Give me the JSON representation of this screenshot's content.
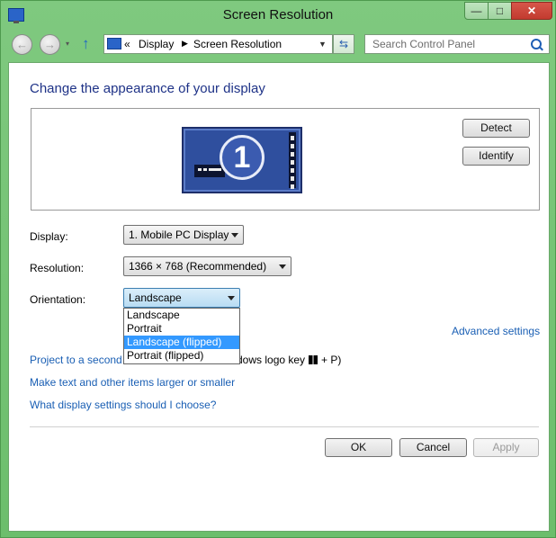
{
  "window": {
    "title": "Screen Resolution"
  },
  "title_buttons": {
    "minimize": "—",
    "maximize": "□",
    "close": "✕"
  },
  "nav": {
    "back_icon": "arrow-left-icon",
    "forward_icon": "arrow-right-icon",
    "recent_glyph": "▾",
    "up_glyph": "↑",
    "address": {
      "prefix": "«",
      "crumbs": [
        "Display",
        "Screen Resolution"
      ],
      "separator": "▶",
      "dropdown_glyph": "▼"
    },
    "refresh_glyph": "⇆",
    "search_placeholder": "Search Control Panel"
  },
  "main": {
    "heading": "Change the appearance of your display",
    "monitor_number": "1",
    "detect_label": "Detect",
    "identify_label": "Identify",
    "fields": {
      "display": {
        "label": "Display:",
        "value": "1. Mobile PC Display"
      },
      "resolution": {
        "label": "Resolution:",
        "value": "1366 × 768 (Recommended)"
      },
      "orientation": {
        "label": "Orientation:",
        "value": "Landscape",
        "options": [
          "Landscape",
          "Portrait",
          "Landscape (flipped)",
          "Portrait (flipped)"
        ],
        "highlighted_index": 2
      }
    },
    "advanced_link": "Advanced settings",
    "project_link": "Project to a second",
    "project_tail_text": "dows logo key",
    "project_tail_suffix": "+ P)",
    "text_size_link": "Make text and other items larger or smaller",
    "choose_link": "What display settings should I choose?",
    "ok_label": "OK",
    "cancel_label": "Cancel",
    "apply_label": "Apply"
  },
  "colors": {
    "frame": "#7fc97f",
    "heading": "#1e3287",
    "link": "#1a5fb4",
    "highlight": "#3399ff"
  }
}
